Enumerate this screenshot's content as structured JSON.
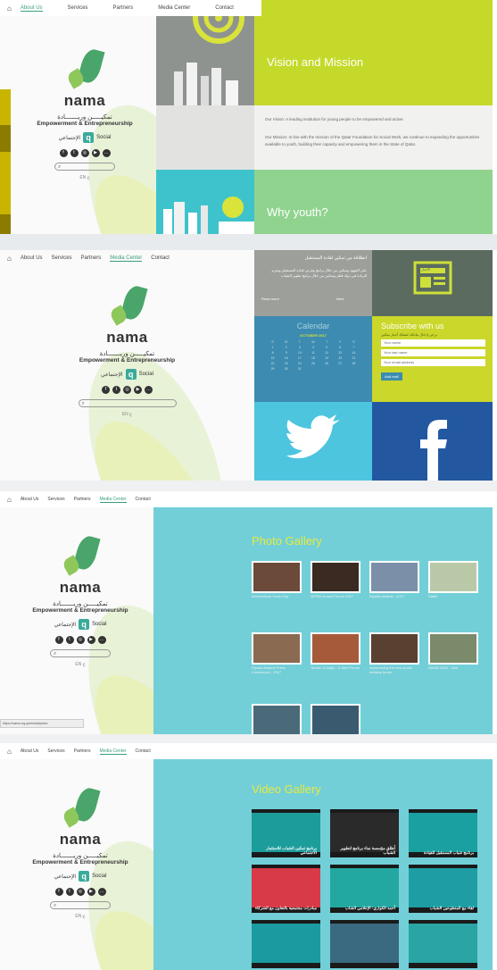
{
  "nav": {
    "home_icon": "home-icon",
    "items": [
      "About Us",
      "Services",
      "Partners",
      "Media Center",
      "Contact"
    ],
    "active_top": "About Us",
    "active_other": "Media Center"
  },
  "logo": {
    "brand": "nama",
    "arabic_line": "تمكيـــــن وريـــــــادة",
    "tagline": "Empowerment & Entrepreneurship",
    "social_ar": "الإجتماعي",
    "social_en": "Social",
    "lang": "EN ع"
  },
  "panel1": {
    "vision_title": "Vision and Mission",
    "vision_text": "Our Vision: A leading institution for young people to be empowered and active.",
    "mission_text": "Our Mission: In line with the mission of the Qatar Foundation for Social Work, we continue to expanding the opportunities available to youth, building their capacity and empowering them in the State of Qatar.",
    "why_title": "Why youth?"
  },
  "panel2": {
    "news_title": "انطلاقة من تمكين لقادة المستقبل",
    "news_text": "على الجهود وتمكين من خلال برامج وفرص لقادة المستقبل وتعزيز الريادة في دولة قطر وتمكين من خلال برامج تطوير الشباب",
    "read_more": "Read more",
    "next": "Next",
    "news_icon_label": "الأخبار",
    "calendar_title": "Calendar",
    "calendar_month": "OCTOBER 2017",
    "calendar_days": [
      "S",
      "M",
      "T",
      "W",
      "T",
      "F",
      "S",
      "1",
      "2",
      "3",
      "4",
      "5",
      "6",
      "7",
      "8",
      "9",
      "10",
      "11",
      "12",
      "13",
      "14",
      "15",
      "16",
      "17",
      "18",
      "19",
      "20",
      "21",
      "22",
      "23",
      "24",
      "25",
      "26",
      "27",
      "28",
      "29",
      "30",
      "31"
    ],
    "subscribe_title": "Subscribe with us",
    "subscribe_ar": "يرجى إدخال بياناتك لتصلك أخبار تمكين",
    "fields": [
      "Your name",
      "Your last name",
      "Your email address"
    ],
    "submit": "Add mail",
    "twitter_icon": "twitter-icon",
    "facebook_icon": "facebook-icon"
  },
  "panel3": {
    "title": "Photo Gallery",
    "photos": [
      "International Youth Day",
      "QFSW Annual Forum 2017",
      "Riyada Awards - 2017",
      "Safeti",
      "Riyada Awards Press Conference - 2017",
      "Tamkin & Majid - A Joint Forum",
      "Announcing the new social ministry forum",
      "SAWN 2016 - Visit",
      "",
      ""
    ],
    "status_url": "https://nama.org.qa/media/photo"
  },
  "panel4": {
    "title": "Video Gallery",
    "videos": [
      "برنامج تمكين الشباب للاستثمار الاجتماعي",
      "أطلق مؤسسة نماء برنامج لتطوير الشباب",
      "برنامج شباب المستقبل للقيادة",
      "مبادرات مجتمعية بالتعاون مع الشركاء",
      "أحمد الكواري: الإعلامي الشاب",
      "لقاء مع المتطوعين الشباب",
      "",
      "",
      ""
    ]
  },
  "colors": {
    "lime": "#c5d92a",
    "teal": "#5fc6cf",
    "accent_green": "#3b9e7a"
  }
}
